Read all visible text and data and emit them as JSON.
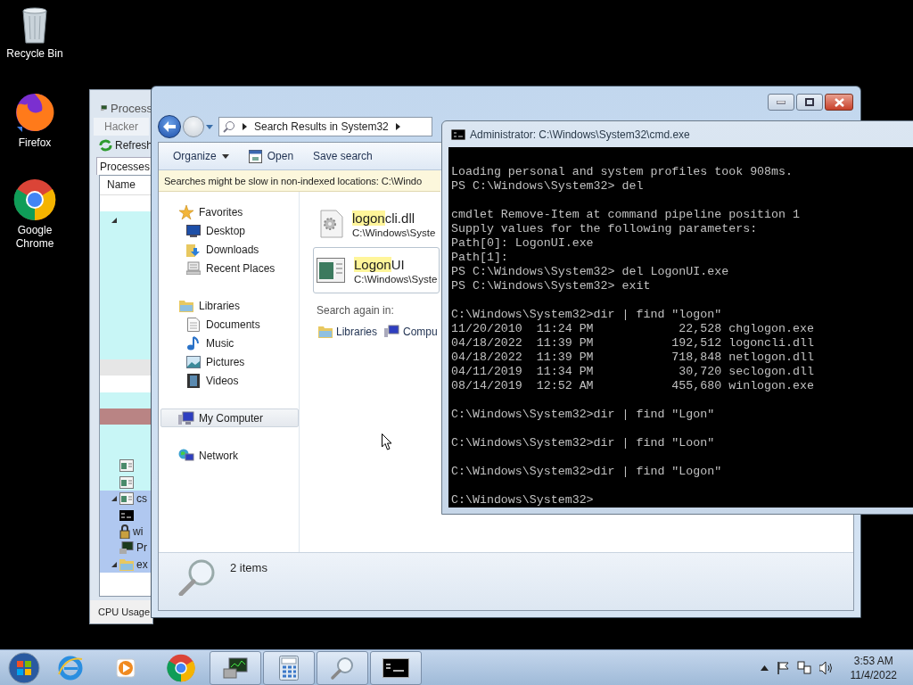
{
  "desktop_icons": [
    {
      "label": "Recycle Bin",
      "kind": "recycle"
    },
    {
      "label": "Firefox",
      "kind": "firefox"
    },
    {
      "label": "Google Chrome",
      "kind": "chrome"
    }
  ],
  "process_hacker": {
    "title": "Process",
    "menu": "Hacker",
    "toolbar": "Refresh",
    "tab": "Processes",
    "column": "Name",
    "status": "CPU Usage",
    "rows": [
      {
        "color": "#ffffff",
        "expanded": false,
        "kind": "plain"
      },
      {
        "color": "#c8f6f6",
        "expanded": true,
        "kind": "plain"
      },
      {
        "color": "#c8f6f6",
        "expanded": false,
        "kind": "plain"
      },
      {
        "color": "#c8f6f6",
        "expanded": false,
        "kind": "plain"
      },
      {
        "color": "#c8f6f6",
        "expanded": false,
        "kind": "plain"
      },
      {
        "color": "#c8f6f6",
        "expanded": false,
        "kind": "plain"
      },
      {
        "color": "#c8f6f6",
        "expanded": false,
        "kind": "plain"
      },
      {
        "color": "#c8f6f6",
        "expanded": false,
        "kind": "plain"
      },
      {
        "color": "#c8f6f6",
        "expanded": false,
        "kind": "plain"
      },
      {
        "color": "#c8f6f6",
        "expanded": false,
        "kind": "plain"
      },
      {
        "color": "#e6e6e6",
        "expanded": false,
        "kind": "plain"
      },
      {
        "color": "#ffffff",
        "expanded": false,
        "kind": "plain"
      },
      {
        "color": "#c8f6f6",
        "expanded": false,
        "kind": "plain"
      },
      {
        "color": "#b98484",
        "expanded": false,
        "kind": "plain"
      },
      {
        "color": "#c8f6f6",
        "expanded": false,
        "kind": "plain"
      },
      {
        "color": "#c8f6f6",
        "expanded": false,
        "kind": "plain"
      },
      {
        "color": "#c8f6f6",
        "expanded": false,
        "kind": "window"
      },
      {
        "color": "#c8f6f6",
        "expanded": false,
        "kind": "window"
      },
      {
        "color": "#b0c8f0",
        "expanded": true,
        "kind": "window",
        "text": "cs"
      },
      {
        "color": "#b0c8f0",
        "expanded": false,
        "kind": "console"
      },
      {
        "color": "#b0c8f0",
        "expanded": false,
        "kind": "service",
        "text": "wi"
      },
      {
        "color": "#b0c8f0",
        "expanded": false,
        "kind": "monitor",
        "text": "Pr"
      },
      {
        "color": "#b0c8f0",
        "expanded": true,
        "kind": "folder",
        "text": "ex"
      }
    ]
  },
  "explorer": {
    "address": "Search Results in System32",
    "toolbar": [
      {
        "label": "Organize",
        "kind": "menu"
      },
      {
        "label": "Open",
        "kind": "icon"
      },
      {
        "label": "Save search",
        "kind": "plain"
      }
    ],
    "info_bar": "Searches might be slow in non-indexed locations: C:\\Windo",
    "nav": [
      {
        "label": "Favorites",
        "kind": "star",
        "selected": false,
        "children": [
          {
            "label": "Desktop",
            "kind": "desktop",
            "selected": false
          },
          {
            "label": "Downloads",
            "kind": "downloads",
            "selected": false
          },
          {
            "label": "Recent Places",
            "kind": "recent",
            "selected": false
          }
        ]
      },
      {
        "label": "Libraries",
        "kind": "library",
        "selected": false,
        "children": [
          {
            "label": "Documents",
            "kind": "documents",
            "selected": false
          },
          {
            "label": "Music",
            "kind": "music",
            "selected": false
          },
          {
            "label": "Pictures",
            "kind": "pictures",
            "selected": false
          },
          {
            "label": "Videos",
            "kind": "videos",
            "selected": false
          }
        ]
      },
      {
        "label": "My Computer",
        "kind": "computer",
        "selected": true
      },
      {
        "label": "Network",
        "kind": "network",
        "selected": false
      }
    ],
    "results": [
      {
        "match": "logon",
        "rest": "cli.dll",
        "path": "C:\\Windows\\Syste",
        "kind": "dll",
        "selected": false
      },
      {
        "match": "Logon",
        "rest": "UI",
        "path": "C:\\Windows\\Syste",
        "kind": "app",
        "selected": true
      }
    ],
    "search_again": {
      "label": "Search again in:",
      "targets": [
        {
          "label": "Libraries",
          "kind": "library"
        },
        {
          "label": "Compu",
          "kind": "computer"
        }
      ]
    },
    "status": "2 items"
  },
  "cmd": {
    "title": "Administrator:  C:\\Windows\\System32\\cmd.exe",
    "blocks": [
      [
        "Loading personal and system profiles took 908ms.",
        "PS C:\\Windows\\System32> del"
      ],
      [
        "cmdlet Remove-Item at command pipeline position 1",
        "Supply values for the following parameters:",
        "Path[0]: LogonUI.exe",
        "Path[1]:",
        "PS C:\\Windows\\System32> del LogonUI.exe",
        "PS C:\\Windows\\System32> exit"
      ],
      [
        "C:\\Windows\\System32>dir | find \"logon\"",
        "11/20/2010  11:24 PM            22,528 chglogon.exe",
        "04/18/2022  11:39 PM           192,512 logoncli.dll",
        "04/18/2022  11:39 PM           718,848 netlogon.dll",
        "04/11/2019  11:34 PM            30,720 seclogon.dll",
        "08/14/2019  12:52 AM           455,680 winlogon.exe"
      ],
      [
        "C:\\Windows\\System32>dir | find \"Lgon\""
      ],
      [
        "C:\\Windows\\System32>dir | find \"Loon\""
      ],
      [
        "C:\\Windows\\System32>dir | find \"Logon\""
      ],
      [
        "C:\\Windows\\System32>"
      ]
    ]
  },
  "taskbar": {
    "items": [
      {
        "kind": "ie",
        "running": false
      },
      {
        "kind": "media",
        "running": false
      },
      {
        "kind": "chrome",
        "running": false
      },
      {
        "kind": "monitor",
        "running": true
      },
      {
        "kind": "calculator",
        "running": true
      },
      {
        "kind": "magnifier",
        "running": true
      },
      {
        "kind": "console",
        "running": true
      }
    ],
    "time": "3:53 AM",
    "date": "11/4/2022"
  }
}
